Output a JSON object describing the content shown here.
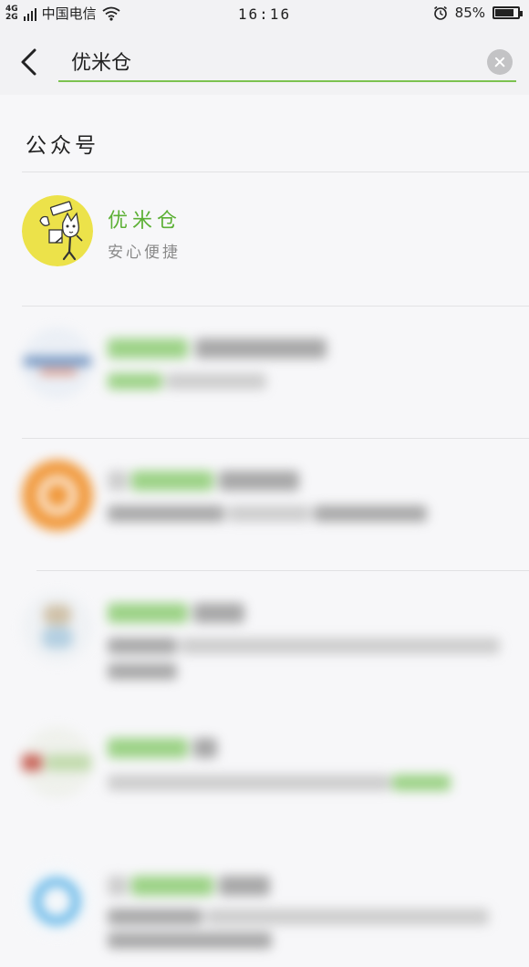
{
  "status_bar": {
    "network": [
      "4G",
      "2G"
    ],
    "carrier": "中国电信",
    "time": "16:16",
    "battery_percent": "85%",
    "battery_level": 0.85
  },
  "search": {
    "query": "优米仓",
    "back_icon": "chevron-left-icon",
    "clear_icon": "clear-circle-icon",
    "accent_color": "#7cc24f"
  },
  "section": {
    "title": "公众号"
  },
  "results": [
    {
      "highlight": "优米仓",
      "rest": "",
      "description": "安心便捷",
      "avatar_color": "#ece24a"
    }
  ]
}
